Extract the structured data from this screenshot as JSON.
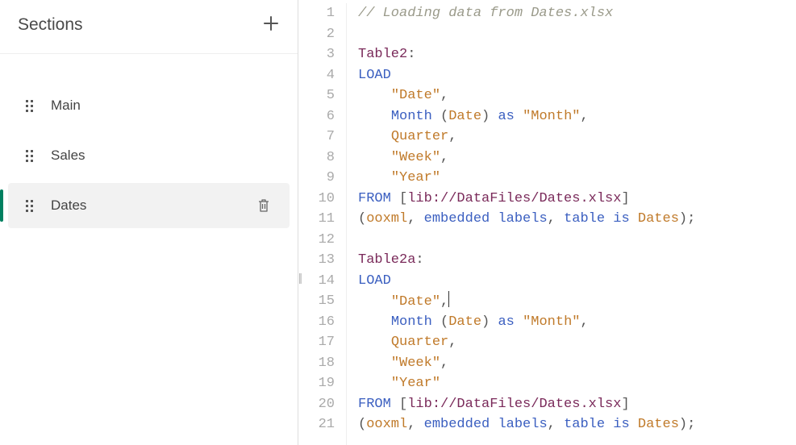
{
  "sidebar": {
    "title": "Sections",
    "add_icon": "plus-icon",
    "items": [
      {
        "label": "Main",
        "active": false
      },
      {
        "label": "Sales",
        "active": false
      },
      {
        "label": "Dates",
        "active": true
      }
    ]
  },
  "editor": {
    "lines": [
      {
        "n": 1,
        "tokens": [
          {
            "t": "// Loading data from Dates.xlsx",
            "c": "comment"
          }
        ]
      },
      {
        "n": 2,
        "tokens": []
      },
      {
        "n": 3,
        "tokens": [
          {
            "t": "Table2",
            "c": "tablename"
          },
          {
            "t": ":",
            "c": "plain"
          }
        ]
      },
      {
        "n": 4,
        "tokens": [
          {
            "t": "LOAD",
            "c": "keyword"
          }
        ]
      },
      {
        "n": 5,
        "tokens": [
          {
            "t": "    ",
            "c": "plain"
          },
          {
            "t": "\"Date\"",
            "c": "string"
          },
          {
            "t": ",",
            "c": "plain"
          }
        ]
      },
      {
        "n": 6,
        "tokens": [
          {
            "t": "    ",
            "c": "plain"
          },
          {
            "t": "Month",
            "c": "func"
          },
          {
            "t": " (",
            "c": "plain"
          },
          {
            "t": "Date",
            "c": "ident"
          },
          {
            "t": ") ",
            "c": "plain"
          },
          {
            "t": "as",
            "c": "keyword"
          },
          {
            "t": " ",
            "c": "plain"
          },
          {
            "t": "\"Month\"",
            "c": "string"
          },
          {
            "t": ",",
            "c": "plain"
          }
        ]
      },
      {
        "n": 7,
        "tokens": [
          {
            "t": "    ",
            "c": "plain"
          },
          {
            "t": "Quarter",
            "c": "ident"
          },
          {
            "t": ",",
            "c": "plain"
          }
        ]
      },
      {
        "n": 8,
        "tokens": [
          {
            "t": "    ",
            "c": "plain"
          },
          {
            "t": "\"Week\"",
            "c": "string"
          },
          {
            "t": ",",
            "c": "plain"
          }
        ]
      },
      {
        "n": 9,
        "tokens": [
          {
            "t": "    ",
            "c": "plain"
          },
          {
            "t": "\"Year\"",
            "c": "string"
          }
        ]
      },
      {
        "n": 10,
        "tokens": [
          {
            "t": "FROM",
            "c": "keyword"
          },
          {
            "t": " [",
            "c": "plain"
          },
          {
            "t": "lib://DataFiles/Dates.xlsx",
            "c": "libpath"
          },
          {
            "t": "]",
            "c": "plain"
          }
        ]
      },
      {
        "n": 11,
        "tokens": [
          {
            "t": "(",
            "c": "plain"
          },
          {
            "t": "ooxml",
            "c": "ident"
          },
          {
            "t": ", ",
            "c": "plain"
          },
          {
            "t": "embedded labels",
            "c": "keyword"
          },
          {
            "t": ", ",
            "c": "plain"
          },
          {
            "t": "table is",
            "c": "istable"
          },
          {
            "t": " ",
            "c": "plain"
          },
          {
            "t": "Dates",
            "c": "ident"
          },
          {
            "t": ");",
            "c": "plain"
          }
        ]
      },
      {
        "n": 12,
        "tokens": []
      },
      {
        "n": 13,
        "tokens": [
          {
            "t": "Table2a",
            "c": "tablename"
          },
          {
            "t": ":",
            "c": "plain"
          }
        ]
      },
      {
        "n": 14,
        "tokens": [
          {
            "t": "LOAD",
            "c": "keyword"
          }
        ]
      },
      {
        "n": 15,
        "tokens": [
          {
            "t": "    ",
            "c": "plain"
          },
          {
            "t": "\"Date\"",
            "c": "string"
          },
          {
            "t": ",",
            "c": "plain"
          }
        ],
        "cursorAfter": true
      },
      {
        "n": 16,
        "tokens": [
          {
            "t": "    ",
            "c": "plain"
          },
          {
            "t": "Month",
            "c": "func"
          },
          {
            "t": " (",
            "c": "plain"
          },
          {
            "t": "Date",
            "c": "ident"
          },
          {
            "t": ") ",
            "c": "plain"
          },
          {
            "t": "as",
            "c": "keyword"
          },
          {
            "t": " ",
            "c": "plain"
          },
          {
            "t": "\"Month\"",
            "c": "string"
          },
          {
            "t": ",",
            "c": "plain"
          }
        ]
      },
      {
        "n": 17,
        "tokens": [
          {
            "t": "    ",
            "c": "plain"
          },
          {
            "t": "Quarter",
            "c": "ident"
          },
          {
            "t": ",",
            "c": "plain"
          }
        ]
      },
      {
        "n": 18,
        "tokens": [
          {
            "t": "    ",
            "c": "plain"
          },
          {
            "t": "\"Week\"",
            "c": "string"
          },
          {
            "t": ",",
            "c": "plain"
          }
        ]
      },
      {
        "n": 19,
        "tokens": [
          {
            "t": "    ",
            "c": "plain"
          },
          {
            "t": "\"Year\"",
            "c": "string"
          }
        ]
      },
      {
        "n": 20,
        "tokens": [
          {
            "t": "FROM",
            "c": "keyword"
          },
          {
            "t": " [",
            "c": "plain"
          },
          {
            "t": "lib://DataFiles/Dates.xlsx",
            "c": "libpath"
          },
          {
            "t": "]",
            "c": "plain"
          }
        ]
      },
      {
        "n": 21,
        "tokens": [
          {
            "t": "(",
            "c": "plain"
          },
          {
            "t": "ooxml",
            "c": "ident"
          },
          {
            "t": ", ",
            "c": "plain"
          },
          {
            "t": "embedded labels",
            "c": "keyword"
          },
          {
            "t": ", ",
            "c": "plain"
          },
          {
            "t": "table is",
            "c": "istable"
          },
          {
            "t": " ",
            "c": "plain"
          },
          {
            "t": "Dates",
            "c": "ident"
          },
          {
            "t": ");",
            "c": "plain"
          }
        ]
      }
    ]
  }
}
